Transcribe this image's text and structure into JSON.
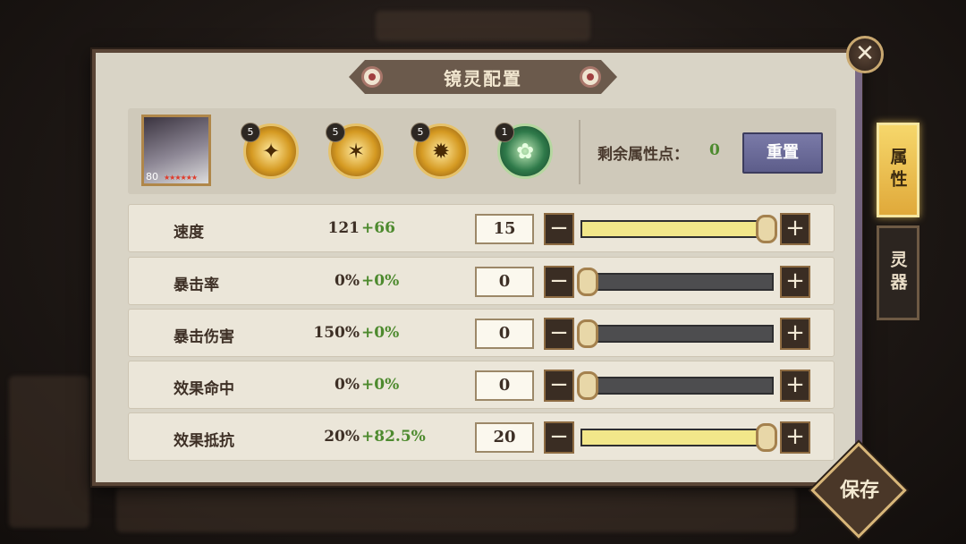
{
  "title": "镜灵配置",
  "close_symbol": "✕",
  "portrait": {
    "level": "80",
    "stars": "★★★★★★"
  },
  "skills": [
    {
      "level": "5",
      "icon": "golden-bolt-icon",
      "glyph": "✦"
    },
    {
      "level": "5",
      "icon": "golden-shuriken-icon",
      "glyph": "✶"
    },
    {
      "level": "5",
      "icon": "golden-slash-icon",
      "glyph": "✹"
    },
    {
      "level": "1",
      "icon": "green-lotus-icon",
      "glyph": "✿"
    }
  ],
  "remaining": {
    "label": "剩余属性点：",
    "value": "0"
  },
  "reset_label": "重置",
  "stats": [
    {
      "name": "速度",
      "base": "121",
      "bonus": "+66",
      "value": "15",
      "fill": 1.0
    },
    {
      "name": "暴击率",
      "base": "0%",
      "bonus": "+0%",
      "value": "0",
      "fill": 0.0
    },
    {
      "name": "暴击伤害",
      "base": "150%",
      "bonus": "+0%",
      "value": "0",
      "fill": 0.0
    },
    {
      "name": "效果命中",
      "base": "0%",
      "bonus": "+0%",
      "value": "0",
      "fill": 0.0
    },
    {
      "name": "效果抵抗",
      "base": "20%",
      "bonus": "+82.5%",
      "value": "20",
      "fill": 1.0
    }
  ],
  "stepper": {
    "minus": "−",
    "plus": "+"
  },
  "tabs": [
    {
      "label": "属性",
      "active": true
    },
    {
      "label": "灵器",
      "active": false
    }
  ],
  "save_label": "保存",
  "colors": {
    "bonus_green": "#4d8a2e",
    "slider_fill": "#f2e78a",
    "reset_button": "#6b6b98",
    "active_tab": "#f2c858"
  }
}
